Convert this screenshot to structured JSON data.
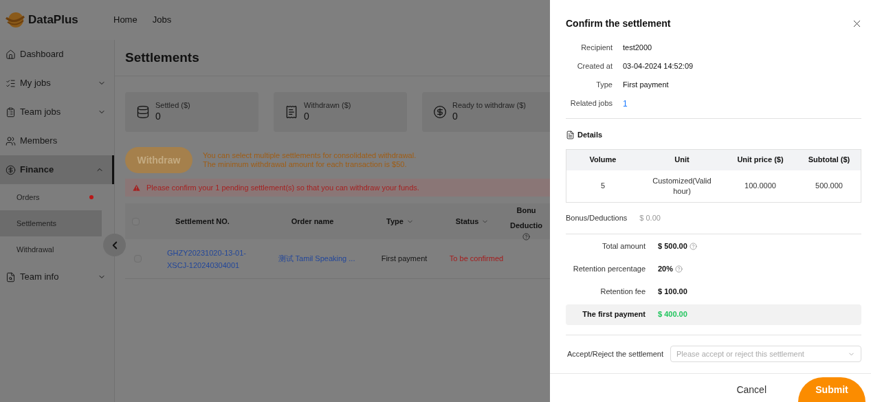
{
  "brand": {
    "name": "DataPlus"
  },
  "top_nav": [
    {
      "label": "Home"
    },
    {
      "label": "Jobs"
    }
  ],
  "sidebar": {
    "items": [
      {
        "label": "Dashboard",
        "selected": false
      },
      {
        "label": "My jobs",
        "selected": false,
        "expanded": false
      },
      {
        "label": "Team jobs",
        "selected": false,
        "expanded": false
      },
      {
        "label": "Members",
        "selected": false
      },
      {
        "label": "Finance",
        "selected": true,
        "expanded": true,
        "children": [
          {
            "label": "Orders",
            "selected": false,
            "notice": true
          },
          {
            "label": "Settlements",
            "selected": true,
            "notice": false
          },
          {
            "label": "Withdrawal",
            "selected": false,
            "notice": false
          }
        ]
      },
      {
        "label": "Team info",
        "selected": false,
        "expanded": false
      }
    ]
  },
  "page": {
    "title": "Settlements",
    "cards": [
      {
        "label": "Settled ($)",
        "value": "0"
      },
      {
        "label": "Withdrawn ($)",
        "value": "0"
      },
      {
        "label": "Ready to withdraw ($)",
        "value": "0"
      }
    ],
    "withdraw_button": {
      "label": "Withdraw",
      "disabled": true
    },
    "hint": "You can select multiple settlements for consolidated withdrawal.\nThe minimum withdrawal amount for each transaction is $50.",
    "alert": "Please confirm your 1 pending settlement(s) so that you can withdraw your funds.",
    "table": {
      "select_all": {
        "checked": false
      },
      "columns": [
        {
          "label": "Settlement NO.",
          "filter": false,
          "help": false
        },
        {
          "label": "Order name",
          "filter": false,
          "help": false
        },
        {
          "label": "Type",
          "filter": true,
          "help": false
        },
        {
          "label": "Status",
          "filter": true,
          "help": false
        },
        {
          "label": "Bonu\nDeductio",
          "filter": false,
          "help": true
        }
      ],
      "rows": [
        {
          "checked": false,
          "settlement_no": "GHZY20231020-13-01-\nXSCJ-120240304001",
          "order_name": "测试 Tamil Speaking ...",
          "type": "First payment",
          "status": "To be confirmed"
        }
      ]
    }
  },
  "drawer": {
    "title": "Confirm the settlement",
    "fields": [
      {
        "label": "Recipient",
        "value": "test2000",
        "kind": "text"
      },
      {
        "label": "Created at",
        "value": "03-04-2024 14:52:09",
        "kind": "text"
      },
      {
        "label": "Type",
        "value": "First payment",
        "kind": "text"
      },
      {
        "label": "Related jobs",
        "value": "1",
        "kind": "link"
      }
    ],
    "details_title": "Details",
    "details_table": {
      "columns": [
        "Volume",
        "Unit",
        "Unit price ($)",
        "Subtotal ($)"
      ],
      "rows": [
        [
          "5",
          "Customized(Valid hour)",
          "100.0000",
          "500.000"
        ]
      ]
    },
    "bonus": {
      "label": "Bonus/Deductions",
      "value": "$ 0.00"
    },
    "amounts": [
      {
        "label": "Total amount",
        "value": "$ 500.00",
        "help": true,
        "highlight": false
      },
      {
        "label": "Retention percentage",
        "value": "20%",
        "help": true,
        "highlight": false
      },
      {
        "label": "Retention fee",
        "value": "$ 100.00",
        "help": false,
        "highlight": false
      },
      {
        "label": "The first payment",
        "value": "$ 400.00",
        "help": false,
        "highlight": true
      }
    ],
    "decision": {
      "label": "Accept/Reject the settlement",
      "placeholder": "Please accept or reject this settlement"
    },
    "buttons": [
      {
        "label": "Cancel",
        "kind": "plain"
      },
      {
        "label": "Submit",
        "kind": "primary"
      }
    ]
  }
}
